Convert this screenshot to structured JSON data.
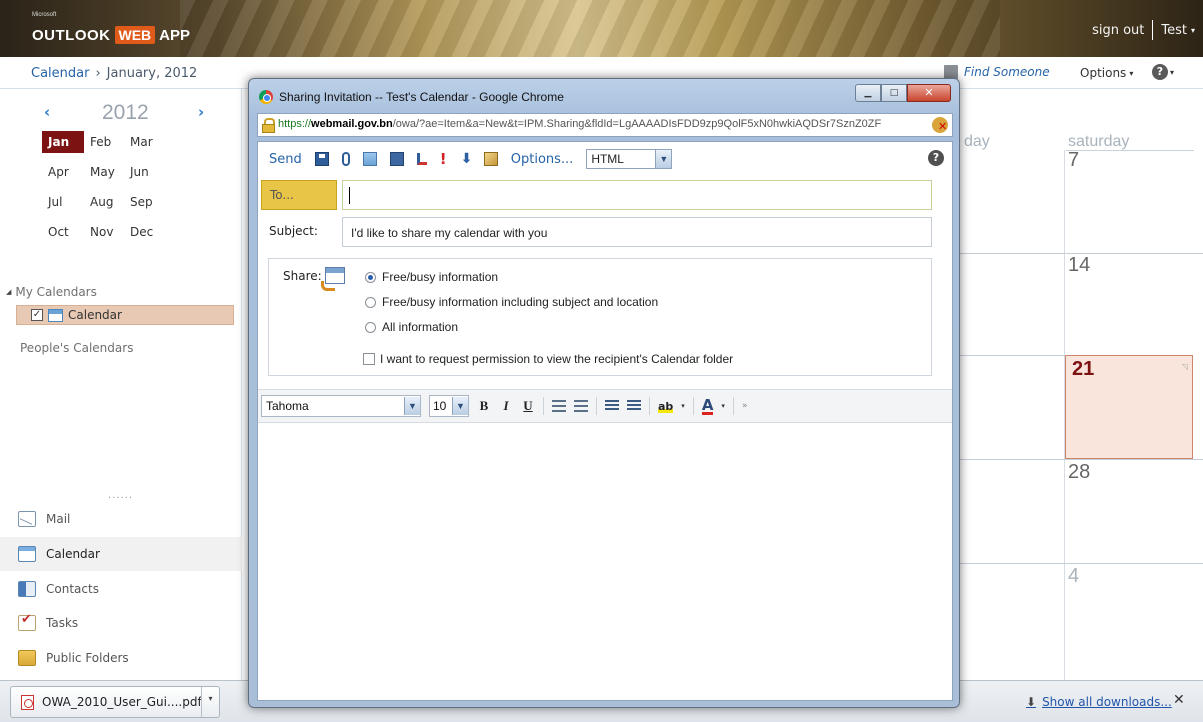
{
  "header": {
    "logo": {
      "microsoft": "Microsoft",
      "outlook": "OUTLOOK",
      "web": "WEB",
      "app": "APP"
    },
    "sign_out": "sign out",
    "user": "Test"
  },
  "breadcrumb": {
    "section": "Calendar",
    "separator": "›",
    "current": "January, 2012"
  },
  "topbar": {
    "find_someone": "Find Someone",
    "options": "Options"
  },
  "mini_calendar": {
    "year": "2012",
    "months": [
      "Jan",
      "Feb",
      "Mar",
      "Apr",
      "May",
      "Jun",
      "Jul",
      "Aug",
      "Sep",
      "Oct",
      "Nov",
      "Dec"
    ],
    "selected_month": "Jan"
  },
  "my_calendars": {
    "title": "My Calendars",
    "items": [
      {
        "label": "Calendar",
        "checked": true
      }
    ]
  },
  "peoples_calendars": "People's Calendars",
  "nav": {
    "grip": "......",
    "items": [
      {
        "label": "Mail",
        "icon": "mail-icon"
      },
      {
        "label": "Calendar",
        "icon": "calendar-icon",
        "active": true
      },
      {
        "label": "Contacts",
        "icon": "contacts-icon"
      },
      {
        "label": "Tasks",
        "icon": "tasks-icon"
      },
      {
        "label": "Public Folders",
        "icon": "folder-icon"
      }
    ]
  },
  "calendar_view": {
    "partial_header": "day",
    "saturday_header": "saturday",
    "dates": [
      "7",
      "14",
      "21",
      "28",
      "4"
    ],
    "today": "21",
    "today_color": "#7d1212"
  },
  "popup": {
    "title": "Sharing Invitation -- Test's Calendar - Google Chrome",
    "url": {
      "scheme": "https://",
      "host": "webmail.gov.bn",
      "path": "/owa/?ae=Item&a=New&t=IPM.Sharing&fldId=LgAAAADIsFDD9zp9QolF5xN0hwkiAQDSr7SznZ0ZF"
    },
    "toolbar": {
      "send": "Send",
      "options": "Options...",
      "format": "HTML"
    },
    "to_label": "To...",
    "to_value": "",
    "subject_label": "Subject:",
    "subject_value": "I'd like to share my calendar with you",
    "share": {
      "label": "Share:",
      "options": [
        {
          "label": "Free/busy information",
          "selected": true
        },
        {
          "label": "Free/busy information including subject and location",
          "selected": false
        },
        {
          "label": "All information",
          "selected": false
        }
      ],
      "request_permission": "I want to request permission to view the recipient's Calendar folder"
    },
    "format_bar": {
      "font": "Tahoma",
      "size": "10",
      "bold": "B",
      "italic": "I",
      "underline": "U",
      "font_color": "A"
    }
  },
  "downloads": {
    "file": "OWA_2010_User_Gui....pdf",
    "show_all": "Show all downloads..."
  },
  "colors": {
    "accent_link": "#2563a8",
    "to_button": "#e8c547",
    "selected_month": "#7d1212"
  }
}
